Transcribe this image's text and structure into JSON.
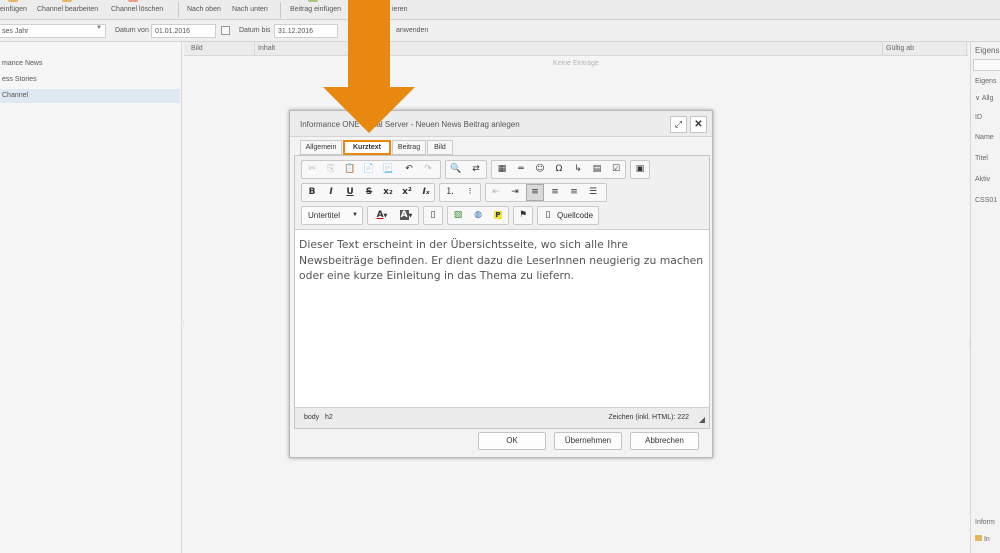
{
  "toolbar": {
    "items": [
      "einfügen",
      "Channel bearbeiten",
      "Channel löschen",
      "Nach oben",
      "Nach unten",
      "Beitrag einfügen",
      "ieren"
    ]
  },
  "filter": {
    "period": "ses Jahr",
    "from_label": "Datum von",
    "from_value": "01.01.2016",
    "to_label": "Datum bis",
    "to_value": "31.12.2016",
    "apply": "anwenden"
  },
  "channels": [
    "mance News",
    "ess Stories",
    "Channel"
  ],
  "grid": {
    "columns": [
      "Bild",
      "Inhalt",
      "Gültig ab"
    ],
    "empty": "Keine Einträge"
  },
  "properties": {
    "title": "Eigens",
    "sub": "Eigens",
    "section": "Allg",
    "fields": [
      "ID",
      "Name",
      "Titel",
      "Aktiv",
      "CSS01"
    ],
    "bottom_title": "Inform",
    "bottom_item": "In"
  },
  "dialog": {
    "title": "Informance ONE Portal Server - Neuen News Beitrag anlegen",
    "maximize_icon": "expand-icon",
    "close_icon": "close-icon",
    "tabs": [
      "Allgemein",
      "Kurztext",
      "Beitrag",
      "Bild"
    ],
    "active_tab": "Kurztext",
    "style_combo": "Untertitel",
    "source_label": "Quellcode",
    "content": "Dieser Text erscheint in der Übersichtsseite, wo sich alle Ihre Newsbeiträge befinden. Er dient dazu die LeserInnen neugierig zu machen oder eine kurze Einleitung in das Thema zu liefern.",
    "path_body": "body",
    "path_h2": "h2",
    "char_count": "Zeichen (inkl. HTML): 222",
    "buttons": {
      "ok": "OK",
      "apply": "Übernehmen",
      "cancel": "Abbrechen"
    }
  },
  "annotation": {
    "arrow_color": "#e8880f"
  },
  "colors": {
    "accent": "#e8880f",
    "selected_row": "#dde8f2"
  }
}
